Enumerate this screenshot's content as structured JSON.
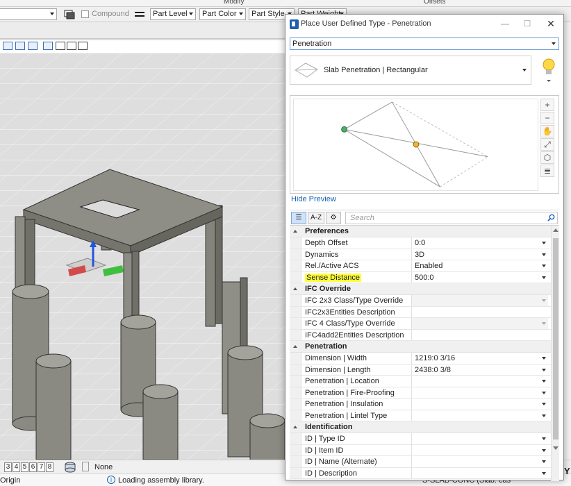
{
  "ribbon": {
    "group_modify": "Modify",
    "group_offsets": "Offsets"
  },
  "attributes_toolbar": {
    "compound_label": "Compound",
    "level": "Part Level",
    "color": "Part Color",
    "style": "Part Style",
    "weight": "Part Weight"
  },
  "status_bar": {
    "views": [
      "3",
      "4",
      "5",
      "6",
      "7",
      "8"
    ],
    "active_view_prefix": "3",
    "snap_value": "None",
    "message": "Loading assembly library.",
    "left_label": "Origin",
    "right_info": "S-SLAB-CONC (Slab: cas",
    "y_label": "Y"
  },
  "dialog": {
    "title": "Place User Defined Type - Penetration",
    "window_buttons": {
      "minimize": "—",
      "maximize": "☐",
      "close": "✕"
    },
    "type_value": "Penetration",
    "item_value": "Slab Penetration | Rectangular",
    "hide_preview": "Hide Preview",
    "preview_tools": [
      "+",
      "−",
      "✋",
      "⤢",
      "⬡",
      "≣"
    ],
    "toolbar": {
      "az_label": "A-Z",
      "search_placeholder": "Search"
    },
    "categories": [
      {
        "name": "Preferences",
        "rows": [
          {
            "key": "Depth Offset",
            "value": "0:0",
            "readonly": false,
            "highlight": false
          },
          {
            "key": "Dynamics",
            "value": "3D",
            "readonly": false,
            "highlight": false
          },
          {
            "key": "Rel./Active ACS",
            "value": "Enabled",
            "readonly": false,
            "highlight": false
          },
          {
            "key": "Sense Distance",
            "value": "500:0",
            "readonly": false,
            "highlight": true
          }
        ]
      },
      {
        "name": "IFC Override",
        "rows": [
          {
            "key": "IFC 2x3 Class/Type Override",
            "value": "",
            "readonly": true,
            "highlight": false
          },
          {
            "key": "IFC2x3Entities Description",
            "value": "",
            "readonly": false,
            "highlight": false,
            "nodrop": true
          },
          {
            "key": "IFC 4 Class/Type Override",
            "value": "",
            "readonly": true,
            "highlight": false
          },
          {
            "key": "IFC4add2Entities Description",
            "value": "",
            "readonly": false,
            "highlight": false,
            "nodrop": true
          }
        ]
      },
      {
        "name": "Penetration",
        "rows": [
          {
            "key": "Dimension | Width",
            "value": "1219:0 3/16",
            "readonly": false,
            "highlight": false
          },
          {
            "key": "Dimension | Length",
            "value": "2438:0 3/8",
            "readonly": false,
            "highlight": false
          },
          {
            "key": "Penetration | Location",
            "value": "",
            "readonly": false,
            "highlight": false
          },
          {
            "key": "Penetration | Fire-Proofing",
            "value": "",
            "readonly": false,
            "highlight": false
          },
          {
            "key": "Penetration | Insulation",
            "value": "",
            "readonly": false,
            "highlight": false
          },
          {
            "key": "Penetration | Lintel Type",
            "value": "",
            "readonly": false,
            "highlight": false
          }
        ]
      },
      {
        "name": "Identification",
        "rows": [
          {
            "key": "ID | Type ID",
            "value": "",
            "readonly": false,
            "highlight": false
          },
          {
            "key": "ID | Item ID",
            "value": "",
            "readonly": false,
            "highlight": false
          },
          {
            "key": "ID | Name (Alternate)",
            "value": "",
            "readonly": false,
            "highlight": false
          },
          {
            "key": "ID | Description",
            "value": "",
            "readonly": false,
            "highlight": false
          }
        ]
      }
    ]
  },
  "colors": {
    "accent": "#1a5fb4",
    "highlight": "#ffff3d",
    "concrete": "#8a8a82"
  }
}
